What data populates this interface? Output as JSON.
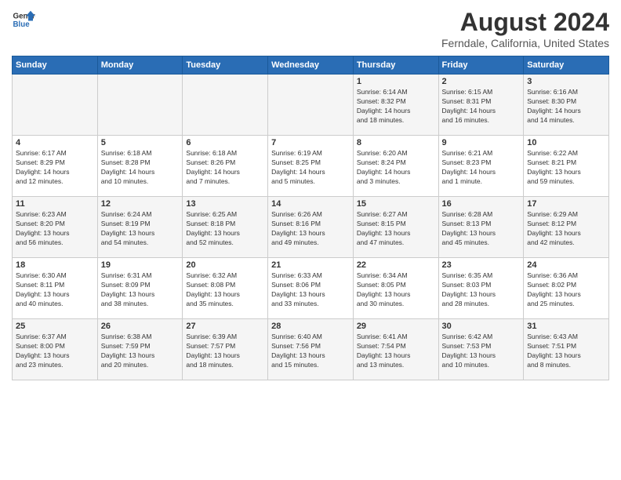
{
  "header": {
    "logo_general": "General",
    "logo_blue": "Blue",
    "title": "August 2024",
    "subtitle": "Ferndale, California, United States"
  },
  "days_of_week": [
    "Sunday",
    "Monday",
    "Tuesday",
    "Wednesday",
    "Thursday",
    "Friday",
    "Saturday"
  ],
  "weeks": [
    [
      {
        "day": "",
        "info": ""
      },
      {
        "day": "",
        "info": ""
      },
      {
        "day": "",
        "info": ""
      },
      {
        "day": "",
        "info": ""
      },
      {
        "day": "1",
        "info": "Sunrise: 6:14 AM\nSunset: 8:32 PM\nDaylight: 14 hours\nand 18 minutes."
      },
      {
        "day": "2",
        "info": "Sunrise: 6:15 AM\nSunset: 8:31 PM\nDaylight: 14 hours\nand 16 minutes."
      },
      {
        "day": "3",
        "info": "Sunrise: 6:16 AM\nSunset: 8:30 PM\nDaylight: 14 hours\nand 14 minutes."
      }
    ],
    [
      {
        "day": "4",
        "info": "Sunrise: 6:17 AM\nSunset: 8:29 PM\nDaylight: 14 hours\nand 12 minutes."
      },
      {
        "day": "5",
        "info": "Sunrise: 6:18 AM\nSunset: 8:28 PM\nDaylight: 14 hours\nand 10 minutes."
      },
      {
        "day": "6",
        "info": "Sunrise: 6:18 AM\nSunset: 8:26 PM\nDaylight: 14 hours\nand 7 minutes."
      },
      {
        "day": "7",
        "info": "Sunrise: 6:19 AM\nSunset: 8:25 PM\nDaylight: 14 hours\nand 5 minutes."
      },
      {
        "day": "8",
        "info": "Sunrise: 6:20 AM\nSunset: 8:24 PM\nDaylight: 14 hours\nand 3 minutes."
      },
      {
        "day": "9",
        "info": "Sunrise: 6:21 AM\nSunset: 8:23 PM\nDaylight: 14 hours\nand 1 minute."
      },
      {
        "day": "10",
        "info": "Sunrise: 6:22 AM\nSunset: 8:21 PM\nDaylight: 13 hours\nand 59 minutes."
      }
    ],
    [
      {
        "day": "11",
        "info": "Sunrise: 6:23 AM\nSunset: 8:20 PM\nDaylight: 13 hours\nand 56 minutes."
      },
      {
        "day": "12",
        "info": "Sunrise: 6:24 AM\nSunset: 8:19 PM\nDaylight: 13 hours\nand 54 minutes."
      },
      {
        "day": "13",
        "info": "Sunrise: 6:25 AM\nSunset: 8:18 PM\nDaylight: 13 hours\nand 52 minutes."
      },
      {
        "day": "14",
        "info": "Sunrise: 6:26 AM\nSunset: 8:16 PM\nDaylight: 13 hours\nand 49 minutes."
      },
      {
        "day": "15",
        "info": "Sunrise: 6:27 AM\nSunset: 8:15 PM\nDaylight: 13 hours\nand 47 minutes."
      },
      {
        "day": "16",
        "info": "Sunrise: 6:28 AM\nSunset: 8:13 PM\nDaylight: 13 hours\nand 45 minutes."
      },
      {
        "day": "17",
        "info": "Sunrise: 6:29 AM\nSunset: 8:12 PM\nDaylight: 13 hours\nand 42 minutes."
      }
    ],
    [
      {
        "day": "18",
        "info": "Sunrise: 6:30 AM\nSunset: 8:11 PM\nDaylight: 13 hours\nand 40 minutes."
      },
      {
        "day": "19",
        "info": "Sunrise: 6:31 AM\nSunset: 8:09 PM\nDaylight: 13 hours\nand 38 minutes."
      },
      {
        "day": "20",
        "info": "Sunrise: 6:32 AM\nSunset: 8:08 PM\nDaylight: 13 hours\nand 35 minutes."
      },
      {
        "day": "21",
        "info": "Sunrise: 6:33 AM\nSunset: 8:06 PM\nDaylight: 13 hours\nand 33 minutes."
      },
      {
        "day": "22",
        "info": "Sunrise: 6:34 AM\nSunset: 8:05 PM\nDaylight: 13 hours\nand 30 minutes."
      },
      {
        "day": "23",
        "info": "Sunrise: 6:35 AM\nSunset: 8:03 PM\nDaylight: 13 hours\nand 28 minutes."
      },
      {
        "day": "24",
        "info": "Sunrise: 6:36 AM\nSunset: 8:02 PM\nDaylight: 13 hours\nand 25 minutes."
      }
    ],
    [
      {
        "day": "25",
        "info": "Sunrise: 6:37 AM\nSunset: 8:00 PM\nDaylight: 13 hours\nand 23 minutes."
      },
      {
        "day": "26",
        "info": "Sunrise: 6:38 AM\nSunset: 7:59 PM\nDaylight: 13 hours\nand 20 minutes."
      },
      {
        "day": "27",
        "info": "Sunrise: 6:39 AM\nSunset: 7:57 PM\nDaylight: 13 hours\nand 18 minutes."
      },
      {
        "day": "28",
        "info": "Sunrise: 6:40 AM\nSunset: 7:56 PM\nDaylight: 13 hours\nand 15 minutes."
      },
      {
        "day": "29",
        "info": "Sunrise: 6:41 AM\nSunset: 7:54 PM\nDaylight: 13 hours\nand 13 minutes."
      },
      {
        "day": "30",
        "info": "Sunrise: 6:42 AM\nSunset: 7:53 PM\nDaylight: 13 hours\nand 10 minutes."
      },
      {
        "day": "31",
        "info": "Sunrise: 6:43 AM\nSunset: 7:51 PM\nDaylight: 13 hours\nand 8 minutes."
      }
    ]
  ]
}
